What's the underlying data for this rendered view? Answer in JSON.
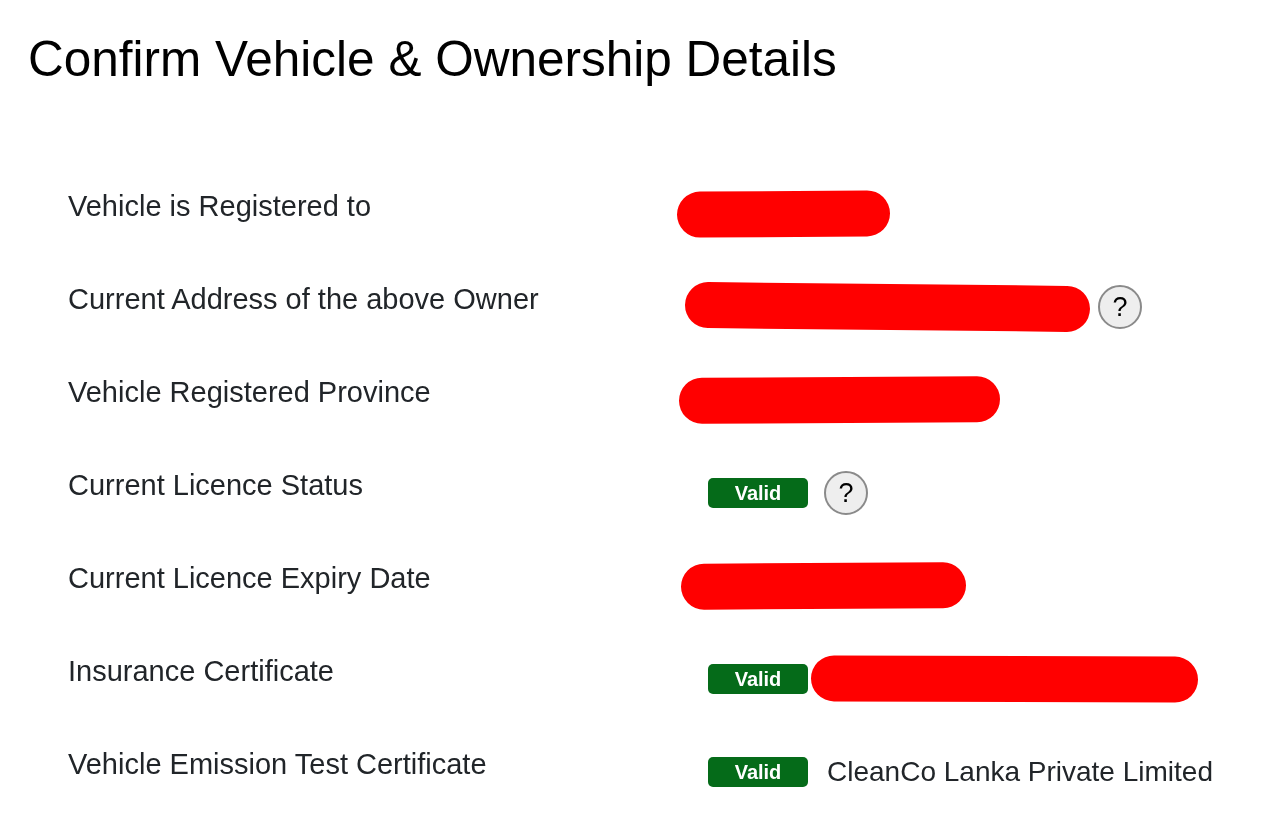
{
  "title": "Confirm Vehicle & Ownership Details",
  "rows": [
    {
      "label": "Vehicle is Registered to",
      "value": [
        {
          "kind": "redaction"
        }
      ]
    },
    {
      "label": "Current Address of the above Owner",
      "value": [
        {
          "kind": "redaction"
        },
        {
          "kind": "help",
          "text": "?"
        }
      ]
    },
    {
      "label": "Vehicle Registered Province",
      "value": [
        {
          "kind": "redaction"
        }
      ]
    },
    {
      "label": "Current Licence Status",
      "value": [
        {
          "kind": "badge",
          "text": "Valid"
        },
        {
          "kind": "help",
          "text": "?"
        }
      ]
    },
    {
      "label": "Current Licence Expiry Date",
      "value": [
        {
          "kind": "redaction"
        }
      ]
    },
    {
      "label": "Insurance Certificate",
      "value": [
        {
          "kind": "badge",
          "text": "Valid"
        },
        {
          "kind": "redaction"
        }
      ]
    },
    {
      "label": "Vehicle Emission Test Certificate",
      "value": [
        {
          "kind": "badge",
          "text": "Valid"
        },
        {
          "kind": "text",
          "text": "CleanCo Lanka Private Limited"
        }
      ]
    }
  ]
}
